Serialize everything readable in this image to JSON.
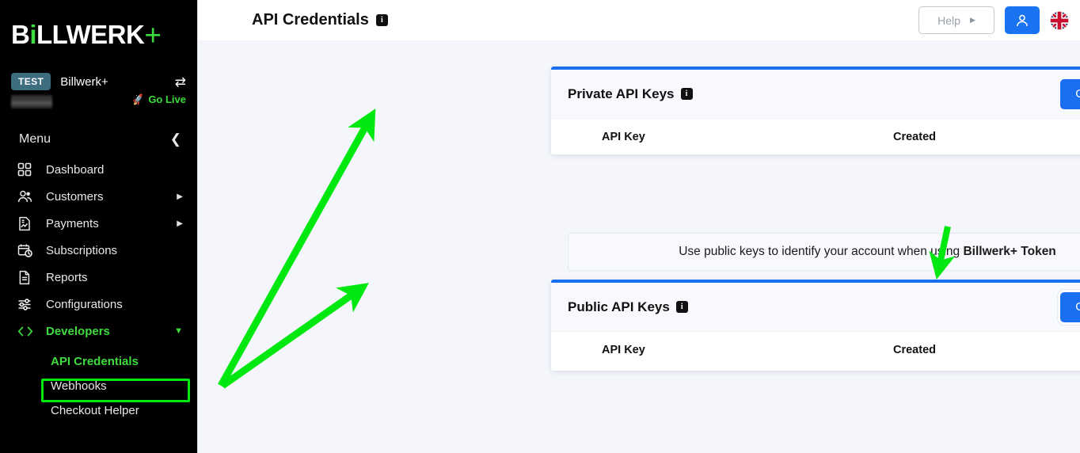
{
  "sidebar": {
    "logo": {
      "part1": "B",
      "part2": "i",
      "part3": "LLWERK",
      "plus": "+"
    },
    "account": {
      "badge": "TEST",
      "name": "Billwerk+",
      "swap_icon": "swap-arrows-icon",
      "go_live": "Go Live"
    },
    "menu_label": "Menu",
    "collapse_icon": "chevron-left-icon",
    "items": [
      {
        "label": "Dashboard",
        "icon": "grid-icon",
        "caret": "",
        "active": false
      },
      {
        "label": "Customers",
        "icon": "users-icon",
        "caret": "▶",
        "active": false
      },
      {
        "label": "Payments",
        "icon": "invoice-icon",
        "caret": "▶",
        "active": false
      },
      {
        "label": "Subscriptions",
        "icon": "calendar-clock-icon",
        "caret": "",
        "active": false
      },
      {
        "label": "Reports",
        "icon": "document-icon",
        "caret": "",
        "active": false
      },
      {
        "label": "Configurations",
        "icon": "sliders-icon",
        "caret": "",
        "active": false
      },
      {
        "label": "Developers",
        "icon": "code-brackets-icon",
        "caret": "▼",
        "active": true
      }
    ],
    "subitems": [
      {
        "label": "API Credentials",
        "highlighted": true
      },
      {
        "label": "Webhooks",
        "highlighted": false
      },
      {
        "label": "Checkout Helper",
        "highlighted": false
      }
    ]
  },
  "topbar": {
    "title": "API Credentials",
    "title_info_icon": "info-icon",
    "help_label": "Help",
    "help_caret_icon": "triangle-right-icon",
    "avatar_icon": "user-icon",
    "language_flag": "uk-flag-icon"
  },
  "cards": [
    {
      "title": "Private API Keys",
      "info_icon": "info-icon",
      "button_label": "Generate New",
      "columns": [
        "API Key",
        "Created"
      ],
      "rows": [],
      "focused": false
    },
    {
      "title": "Public API Keys",
      "info_icon": "info-icon",
      "button_label": "Generate New",
      "columns": [
        "API Key",
        "Created"
      ],
      "rows": [],
      "focused": true
    }
  ],
  "notice": {
    "text_before": "Use public keys to identify your account when using ",
    "text_bold": "Billwerk+ Token",
    "expand_icon": "chevron-down-icon"
  },
  "colors": {
    "accent_blue": "#1a6ef0",
    "brand_green": "#3ddb3d",
    "annotation_green": "#00e810",
    "sidebar_bg": "#000000",
    "content_bg": "#f4f6fb",
    "test_badge": "#3d6e80"
  }
}
